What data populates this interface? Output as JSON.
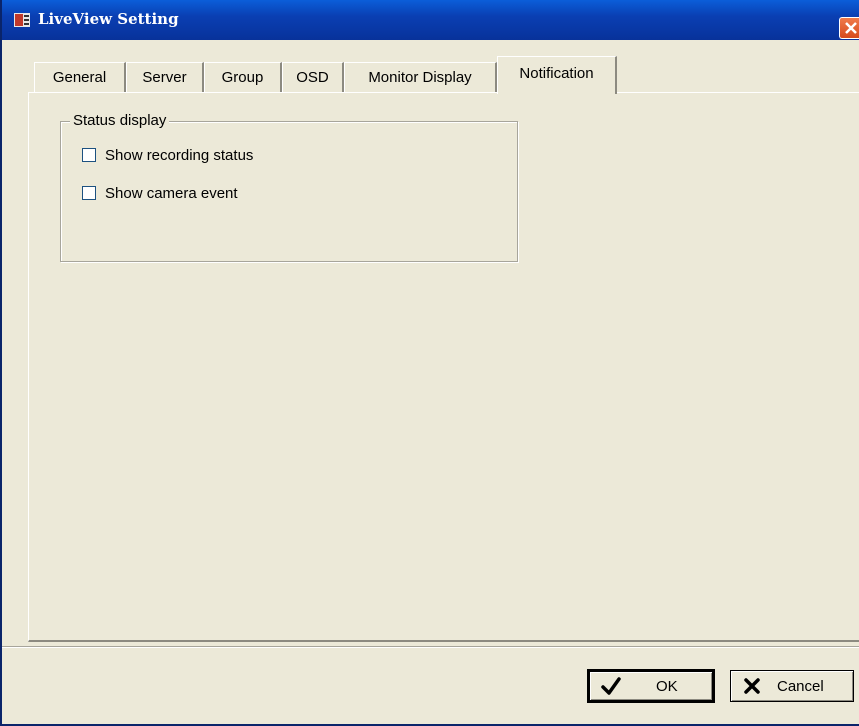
{
  "window": {
    "title": "LiveView Setting"
  },
  "tabs": [
    {
      "label": "General",
      "active": false
    },
    {
      "label": "Server",
      "active": false
    },
    {
      "label": "Group",
      "active": false
    },
    {
      "label": "OSD",
      "active": false
    },
    {
      "label": "Monitor Display",
      "active": false
    },
    {
      "label": "Notification",
      "active": true
    }
  ],
  "notification": {
    "group_title": "Status display",
    "options": [
      {
        "label": "Show recording status",
        "checked": false
      },
      {
        "label": "Show camera event",
        "checked": false
      }
    ]
  },
  "buttons": {
    "ok_label": "OK",
    "ok_icon": "checkmark-icon",
    "cancel_label": "Cancel",
    "cancel_icon": "x-icon"
  },
  "colors": {
    "titlebar": "#0a3fb3",
    "face": "#ece9d8",
    "close": "#d64a1c"
  }
}
